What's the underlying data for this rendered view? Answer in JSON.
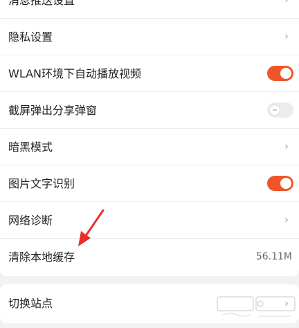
{
  "accent_color": "#f0552a",
  "toggle_off_color": "#ececec",
  "settings": {
    "rows": [
      {
        "label": "消息推送设置",
        "control": "chevron",
        "chevron": "›"
      },
      {
        "label": "隐私设置",
        "control": "chevron",
        "chevron": "›"
      },
      {
        "label": "WLAN环境下自动播放视频",
        "control": "toggle",
        "toggle_on": true
      },
      {
        "label": "截屏弹出分享弹窗",
        "control": "toggle",
        "toggle_on": false
      },
      {
        "label": "暗黑模式",
        "control": "chevron",
        "chevron": "›"
      },
      {
        "label": "图片文字识别",
        "control": "toggle",
        "toggle_on": true
      },
      {
        "label": "网络诊断",
        "control": "chevron",
        "chevron": "›"
      },
      {
        "label": "清除本地缓存",
        "control": "value",
        "value": "56.11M"
      }
    ]
  },
  "site": {
    "label": "切换站点",
    "chevron": "›"
  },
  "annotation": {
    "arrow_color": "#e8302a",
    "icon": "red-arrow-icon"
  },
  "watermark": {
    "icon": "baidu-jingyan-watermark-icon"
  }
}
